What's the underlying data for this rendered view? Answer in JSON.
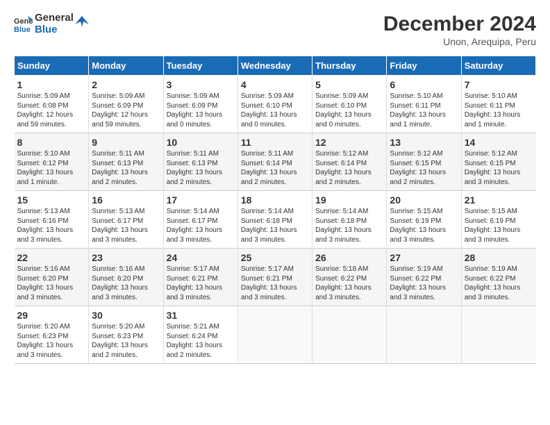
{
  "header": {
    "logo_line1": "General",
    "logo_line2": "Blue",
    "title": "December 2024",
    "subtitle": "Unon, Arequipa, Peru"
  },
  "columns": [
    "Sunday",
    "Monday",
    "Tuesday",
    "Wednesday",
    "Thursday",
    "Friday",
    "Saturday"
  ],
  "weeks": [
    [
      {
        "day": "1",
        "lines": [
          "Sunrise: 5:09 AM",
          "Sunset: 6:08 PM",
          "Daylight: 12 hours",
          "and 59 minutes."
        ]
      },
      {
        "day": "2",
        "lines": [
          "Sunrise: 5:09 AM",
          "Sunset: 6:09 PM",
          "Daylight: 12 hours",
          "and 59 minutes."
        ]
      },
      {
        "day": "3",
        "lines": [
          "Sunrise: 5:09 AM",
          "Sunset: 6:09 PM",
          "Daylight: 13 hours",
          "and 0 minutes."
        ]
      },
      {
        "day": "4",
        "lines": [
          "Sunrise: 5:09 AM",
          "Sunset: 6:10 PM",
          "Daylight: 13 hours",
          "and 0 minutes."
        ]
      },
      {
        "day": "5",
        "lines": [
          "Sunrise: 5:09 AM",
          "Sunset: 6:10 PM",
          "Daylight: 13 hours",
          "and 0 minutes."
        ]
      },
      {
        "day": "6",
        "lines": [
          "Sunrise: 5:10 AM",
          "Sunset: 6:11 PM",
          "Daylight: 13 hours",
          "and 1 minute."
        ]
      },
      {
        "day": "7",
        "lines": [
          "Sunrise: 5:10 AM",
          "Sunset: 6:11 PM",
          "Daylight: 13 hours",
          "and 1 minute."
        ]
      }
    ],
    [
      {
        "day": "8",
        "lines": [
          "Sunrise: 5:10 AM",
          "Sunset: 6:12 PM",
          "Daylight: 13 hours",
          "and 1 minute."
        ]
      },
      {
        "day": "9",
        "lines": [
          "Sunrise: 5:11 AM",
          "Sunset: 6:13 PM",
          "Daylight: 13 hours",
          "and 2 minutes."
        ]
      },
      {
        "day": "10",
        "lines": [
          "Sunrise: 5:11 AM",
          "Sunset: 6:13 PM",
          "Daylight: 13 hours",
          "and 2 minutes."
        ]
      },
      {
        "day": "11",
        "lines": [
          "Sunrise: 5:11 AM",
          "Sunset: 6:14 PM",
          "Daylight: 13 hours",
          "and 2 minutes."
        ]
      },
      {
        "day": "12",
        "lines": [
          "Sunrise: 5:12 AM",
          "Sunset: 6:14 PM",
          "Daylight: 13 hours",
          "and 2 minutes."
        ]
      },
      {
        "day": "13",
        "lines": [
          "Sunrise: 5:12 AM",
          "Sunset: 6:15 PM",
          "Daylight: 13 hours",
          "and 2 minutes."
        ]
      },
      {
        "day": "14",
        "lines": [
          "Sunrise: 5:12 AM",
          "Sunset: 6:15 PM",
          "Daylight: 13 hours",
          "and 3 minutes."
        ]
      }
    ],
    [
      {
        "day": "15",
        "lines": [
          "Sunrise: 5:13 AM",
          "Sunset: 6:16 PM",
          "Daylight: 13 hours",
          "and 3 minutes."
        ]
      },
      {
        "day": "16",
        "lines": [
          "Sunrise: 5:13 AM",
          "Sunset: 6:17 PM",
          "Daylight: 13 hours",
          "and 3 minutes."
        ]
      },
      {
        "day": "17",
        "lines": [
          "Sunrise: 5:14 AM",
          "Sunset: 6:17 PM",
          "Daylight: 13 hours",
          "and 3 minutes."
        ]
      },
      {
        "day": "18",
        "lines": [
          "Sunrise: 5:14 AM",
          "Sunset: 6:18 PM",
          "Daylight: 13 hours",
          "and 3 minutes."
        ]
      },
      {
        "day": "19",
        "lines": [
          "Sunrise: 5:14 AM",
          "Sunset: 6:18 PM",
          "Daylight: 13 hours",
          "and 3 minutes."
        ]
      },
      {
        "day": "20",
        "lines": [
          "Sunrise: 5:15 AM",
          "Sunset: 6:19 PM",
          "Daylight: 13 hours",
          "and 3 minutes."
        ]
      },
      {
        "day": "21",
        "lines": [
          "Sunrise: 5:15 AM",
          "Sunset: 6:19 PM",
          "Daylight: 13 hours",
          "and 3 minutes."
        ]
      }
    ],
    [
      {
        "day": "22",
        "lines": [
          "Sunrise: 5:16 AM",
          "Sunset: 6:20 PM",
          "Daylight: 13 hours",
          "and 3 minutes."
        ]
      },
      {
        "day": "23",
        "lines": [
          "Sunrise: 5:16 AM",
          "Sunset: 6:20 PM",
          "Daylight: 13 hours",
          "and 3 minutes."
        ]
      },
      {
        "day": "24",
        "lines": [
          "Sunrise: 5:17 AM",
          "Sunset: 6:21 PM",
          "Daylight: 13 hours",
          "and 3 minutes."
        ]
      },
      {
        "day": "25",
        "lines": [
          "Sunrise: 5:17 AM",
          "Sunset: 6:21 PM",
          "Daylight: 13 hours",
          "and 3 minutes."
        ]
      },
      {
        "day": "26",
        "lines": [
          "Sunrise: 5:18 AM",
          "Sunset: 6:22 PM",
          "Daylight: 13 hours",
          "and 3 minutes."
        ]
      },
      {
        "day": "27",
        "lines": [
          "Sunrise: 5:19 AM",
          "Sunset: 6:22 PM",
          "Daylight: 13 hours",
          "and 3 minutes."
        ]
      },
      {
        "day": "28",
        "lines": [
          "Sunrise: 5:19 AM",
          "Sunset: 6:22 PM",
          "Daylight: 13 hours",
          "and 3 minutes."
        ]
      }
    ],
    [
      {
        "day": "29",
        "lines": [
          "Sunrise: 5:20 AM",
          "Sunset: 6:23 PM",
          "Daylight: 13 hours",
          "and 3 minutes."
        ]
      },
      {
        "day": "30",
        "lines": [
          "Sunrise: 5:20 AM",
          "Sunset: 6:23 PM",
          "Daylight: 13 hours",
          "and 2 minutes."
        ]
      },
      {
        "day": "31",
        "lines": [
          "Sunrise: 5:21 AM",
          "Sunset: 6:24 PM",
          "Daylight: 13 hours",
          "and 2 minutes."
        ]
      },
      null,
      null,
      null,
      null
    ]
  ]
}
